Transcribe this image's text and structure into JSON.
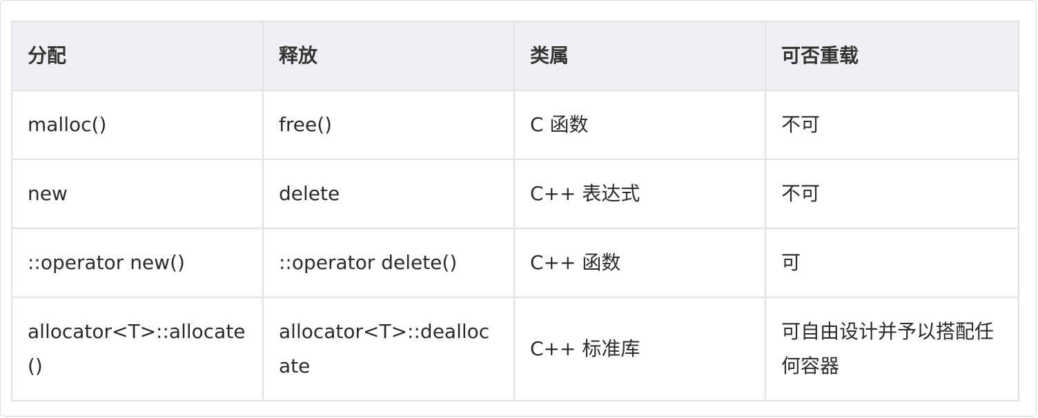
{
  "table": {
    "headers": [
      "分配",
      "释放",
      "类属",
      "可否重载"
    ],
    "rows": [
      [
        "malloc()",
        "free()",
        "C 函数",
        "不可"
      ],
      [
        "new",
        "delete",
        "C++ 表达式",
        "不可"
      ],
      [
        "::operator new()",
        "::operator delete()",
        "C++ 函数",
        "可"
      ],
      [
        "allocator<T>::allocate()",
        "allocator<T>::deallocate",
        "C++ 标准库",
        "可自由设计并予以搭配任何容器"
      ]
    ]
  },
  "colors": {
    "header_background": "#eef0f3",
    "border": "#dfe2e5",
    "text": "#2a2a2a"
  }
}
